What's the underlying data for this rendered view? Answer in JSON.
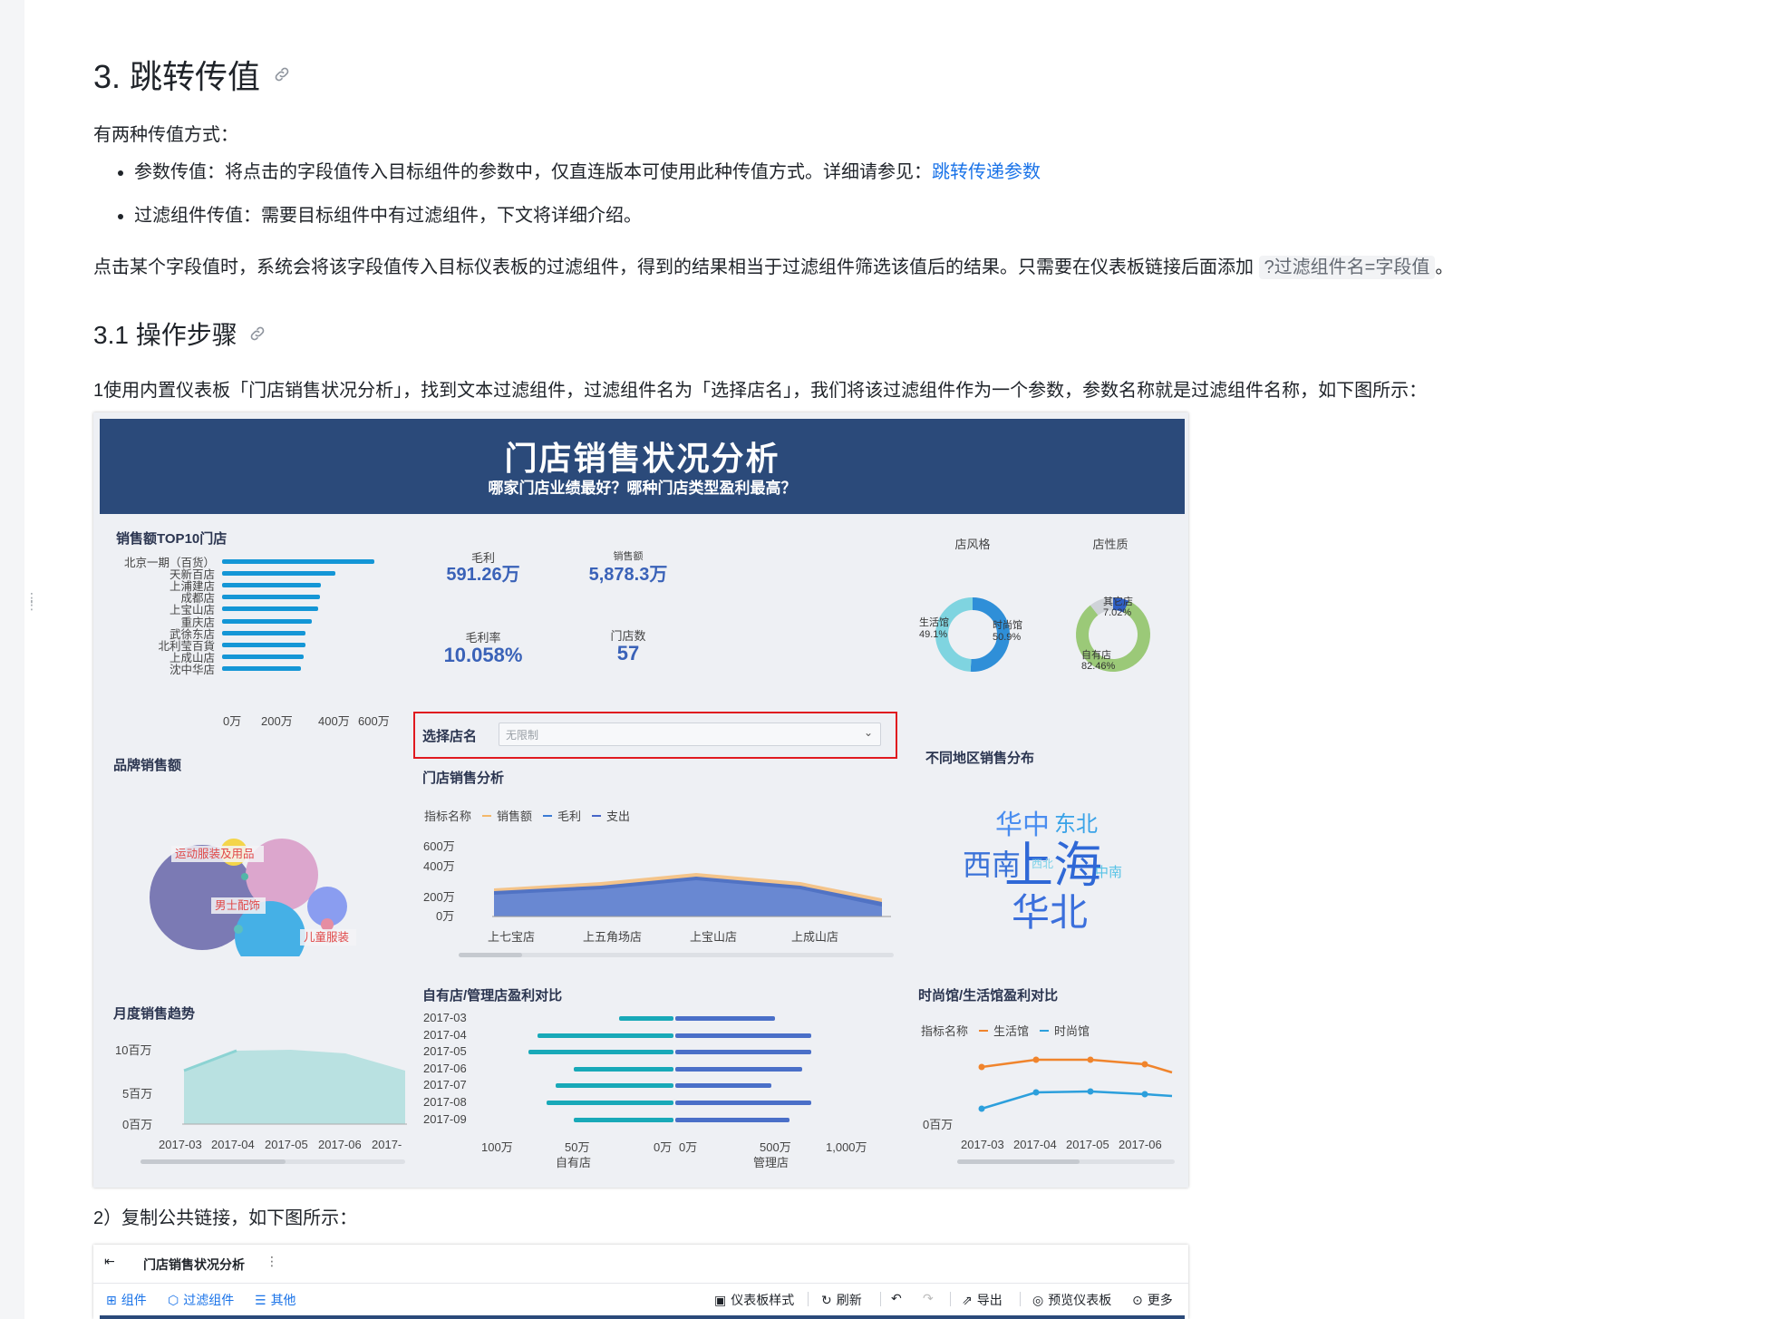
{
  "article": {
    "section_title": "3. 跳转传值",
    "intro": "有两种传值方式：",
    "bullets": [
      {
        "text": "参数传值：将点击的字段值传入目标组件的参数中，仅直连版本可使用此种传值方式。详细请参见：",
        "link": "跳转传递参数"
      },
      {
        "text": "过滤组件传值：需要目标组件中有过滤组件，下文将详细介绍。"
      }
    ],
    "para": "点击某个字段值时，系统会将该字段值传入目标仪表板的过滤组件，得到的结果相当于过滤组件筛选该值后的结果。只需要在仪表板链接后面添加",
    "para_code": "?过滤组件名=字段值",
    "para_end": "。",
    "sub_title": "3.1 操作步骤",
    "step1": "1使用内置仪表板「门店销售状况分析」，找到文本过滤组件，过滤组件名为「选择店名」，我们将该过滤组件作为一个参数，参数名称就是过滤组件名称，如下图所示：",
    "step2": "2）复制公共链接，如下图所示："
  },
  "dashboard": {
    "title": "门店销售状况分析",
    "subtitle": "哪家门店业绩最好？哪种门店类型盈利最高？",
    "top10": {
      "title": "销售额TOP10门店",
      "stores": [
        "北京一期（百货）",
        "天新百店",
        "上浦建店",
        "成都店",
        "上宝山店",
        "重庆店",
        "武徐东店",
        "北利莹百貨",
        "上成山店",
        "沈中华店"
      ],
      "values": [
        600,
        445,
        390,
        385,
        380,
        355,
        330,
        330,
        320,
        310
      ],
      "ticks": [
        "0万",
        "200万",
        "400万",
        "600万"
      ]
    },
    "kpis": [
      {
        "label": "毛利",
        "value": "591.26万"
      },
      {
        "label": "销售额",
        "value": "5,878.3万"
      },
      {
        "label": "毛利率",
        "value": "10.058%"
      },
      {
        "label": "门店数",
        "value": "57"
      }
    ],
    "donuts": {
      "style": {
        "title": "店风格",
        "a_label": "生活馆",
        "a_pct": "49.1%",
        "b_label": "时尚馆",
        "b_pct": "50.9%",
        "a_value": 49.1,
        "b_value": 50.9
      },
      "nature": {
        "title": "店性质",
        "a_label": "其它店",
        "a_pct": "7.02%",
        "b_label": "自有店",
        "b_pct": "82.46%",
        "a_value": 7.02,
        "b_value": 82.46
      }
    },
    "filter": {
      "label": "选择店名",
      "placeholder": "无限制"
    },
    "brand": {
      "title": "品牌销售额",
      "labels": [
        "运动服装及用品",
        "男士配饰",
        "儿童服装"
      ]
    },
    "store_analysis": {
      "title": "门店销售分析",
      "legend_title": "指标名称",
      "legend": [
        "销售额",
        "毛利",
        "支出"
      ],
      "yticks": [
        "600万",
        "400万",
        "200万",
        "0万"
      ],
      "xticks": [
        "上七宝店",
        "上五角场店",
        "上宝山店",
        "上成山店"
      ]
    },
    "region": {
      "title": "不同地区销售分布",
      "words": [
        "华中",
        "东北",
        "西南",
        "上海",
        "西北",
        "中南",
        "华北"
      ]
    },
    "monthly": {
      "title": "月度销售趋势",
      "yticks": [
        "10百万",
        "5百万",
        "0百万"
      ],
      "xticks": [
        "2017-03",
        "2017-04",
        "2017-05",
        "2017-06",
        "2017-"
      ]
    },
    "own_vs_managed": {
      "title": "自有店/管理店盈利对比",
      "months": [
        "2017-03",
        "2017-04",
        "2017-05",
        "2017-06",
        "2017-07",
        "2017-08",
        "2017-09"
      ],
      "left_values": [
        30,
        75,
        80,
        55,
        65,
        70,
        55
      ],
      "right_values": [
        55,
        75,
        75,
        70,
        53,
        75,
        63
      ],
      "left_ticks": [
        "100万",
        "50万",
        "0万"
      ],
      "right_ticks": [
        "0万",
        "500万",
        "1,000万"
      ],
      "left_axis": "自有店",
      "right_axis": "管理店"
    },
    "fashion_vs_life": {
      "title": "时尚馆/生活馆盈利对比",
      "legend_title": "指标名称",
      "legend": [
        "生活馆",
        "时尚馆"
      ],
      "ytick": "0百万",
      "xticks": [
        "2017-03",
        "2017-04",
        "2017-05",
        "2017-06"
      ]
    }
  },
  "toolbar": {
    "title": "门店销售状况分析",
    "more_dots": "⋮",
    "left": [
      {
        "label": "组件"
      },
      {
        "label": "过滤组件"
      },
      {
        "label": "其他"
      }
    ],
    "right": [
      {
        "label": "仪表板样式"
      },
      {
        "label": "刷新"
      },
      {
        "label": "导出"
      },
      {
        "label": "预览仪表板"
      },
      {
        "label": "更多"
      }
    ]
  },
  "colors": {
    "header": "#2b4a7a",
    "accent": "#1496d6",
    "link": "#1a73e8",
    "highlight": "#e0191f"
  }
}
